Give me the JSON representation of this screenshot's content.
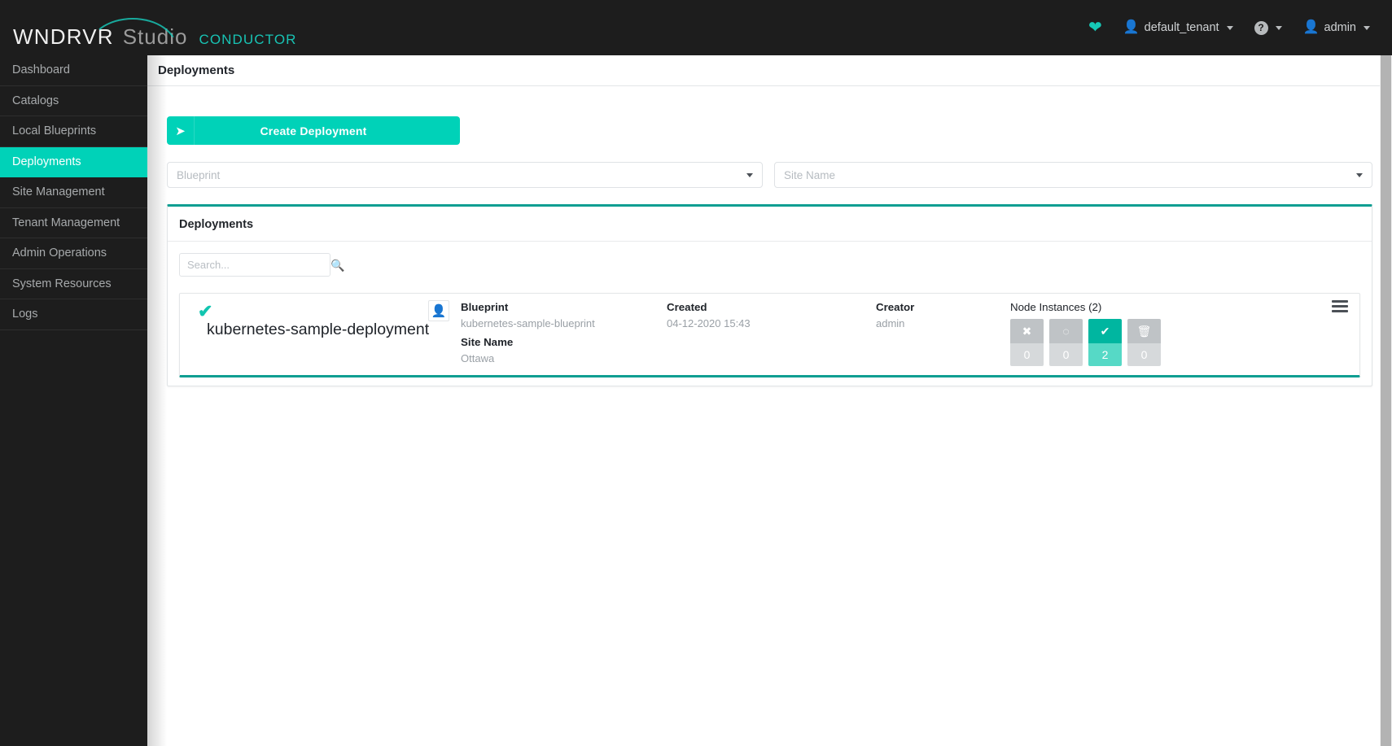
{
  "brand": {
    "wndrvr": "WNDRVR",
    "studio": "Studio",
    "product": "CONDUCTOR"
  },
  "topbar": {
    "health_icon": "heartbeat-icon",
    "tenant_icon": "person-icon",
    "tenant": "default_tenant",
    "help_icon": "question-mark-icon",
    "user_icon": "user-icon",
    "user": "admin"
  },
  "sidebar": {
    "items": [
      {
        "label": "Dashboard",
        "active": false
      },
      {
        "label": "Catalogs",
        "active": false
      },
      {
        "label": "Local Blueprints",
        "active": false
      },
      {
        "label": "Deployments",
        "active": true
      },
      {
        "label": "Site Management",
        "active": false
      },
      {
        "label": "Tenant Management",
        "active": false
      },
      {
        "label": "Admin Operations",
        "active": false
      },
      {
        "label": "System Resources",
        "active": false
      },
      {
        "label": "Logs",
        "active": false
      }
    ]
  },
  "page": {
    "title": "Deployments"
  },
  "toolbar": {
    "create_label": "Create Deployment",
    "create_icon": "rocket-icon"
  },
  "filters": {
    "blueprint_placeholder": "Blueprint",
    "blueprint_value": "",
    "site_placeholder": "Site Name",
    "site_value": ""
  },
  "panel": {
    "title": "Deployments",
    "search_placeholder": "Search...",
    "search_value": "",
    "search_icon": "magnifier-icon"
  },
  "deployment": {
    "status_icon": "check-icon",
    "name": "kubernetes-sample-deployment",
    "avatar_icon": "user-avatar-icon",
    "fields": [
      {
        "label": "Blueprint",
        "value": "kubernetes-sample-blueprint"
      },
      {
        "label": "Site Name",
        "value": "Ottawa"
      },
      {
        "label": "Created",
        "value": "04-12-2020 15:43"
      },
      {
        "label": "Creator",
        "value": "admin"
      }
    ],
    "node_instances": {
      "title": "Node Instances (2)",
      "badges": [
        {
          "icon": "x-icon",
          "glyph": "✖",
          "count": "0",
          "state": "grey"
        },
        {
          "icon": "spinner-icon",
          "glyph": "◌",
          "count": "0",
          "state": "grey"
        },
        {
          "icon": "check-icon",
          "glyph": "✔",
          "count": "2",
          "state": "green"
        },
        {
          "icon": "trash-icon",
          "glyph": "🗑",
          "count": "0",
          "state": "grey"
        }
      ]
    },
    "menu_icon": "hamburger-menu-icon"
  },
  "colors": {
    "accent_teal": "#00d2b8",
    "accent_dark_teal": "#0e9e92",
    "sidebar_bg": "#1d1d1d",
    "badge_green": "#00b6a0",
    "badge_grey": "#bfc3c6"
  }
}
